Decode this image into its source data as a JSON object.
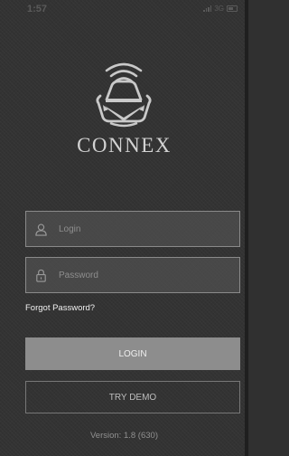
{
  "status_bar": {
    "time": "1:57",
    "network": "3G"
  },
  "brand": {
    "name": "CONNEX"
  },
  "form": {
    "login_placeholder": "Login",
    "password_placeholder": "Password",
    "login_icon": "user-icon",
    "password_icon": "lock-icon",
    "forgot_password": "Forgot Password?"
  },
  "buttons": {
    "login_label": "LOGIN",
    "demo_label": "TRY DEMO"
  },
  "footer": {
    "version": "Version: 1.8 (630)"
  },
  "colors": {
    "background": "#333333",
    "login_button": "#8d8d8d",
    "text_light": "#f0f0f0"
  }
}
